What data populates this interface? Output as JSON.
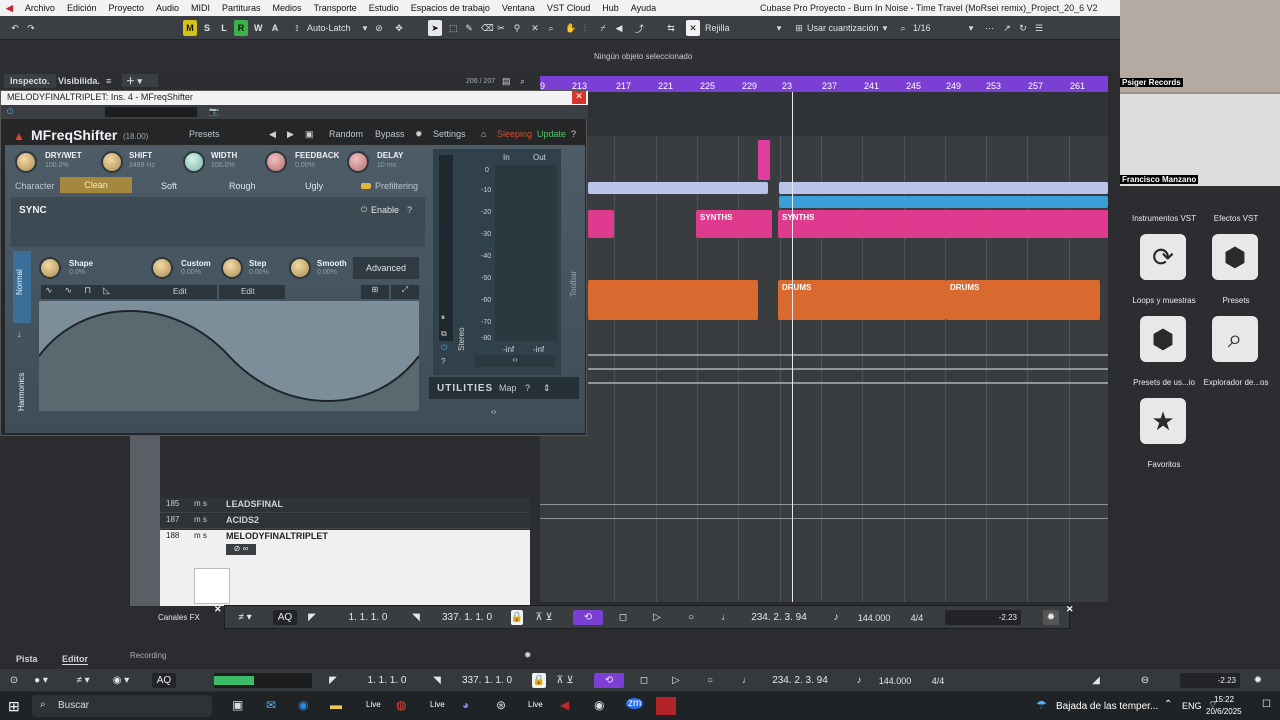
{
  "menubar": {
    "items": [
      "Archivo",
      "Edición",
      "Proyecto",
      "Audio",
      "MIDI",
      "Partituras",
      "Medios",
      "Transporte",
      "Estudio",
      "Espacios de trabajo",
      "Ventana",
      "VST Cloud",
      "Hub",
      "Ayuda"
    ],
    "window_title": "Cubase Pro Proyecto - Burn In Noise - Time Travel (MoRsei remix)_Project_20_6 V2"
  },
  "toolbar": {
    "m": "M",
    "s": "S",
    "l": "L",
    "r": "R",
    "w": "W",
    "a": "A",
    "autolatch": "Auto-Latch",
    "grid": "Rejilla",
    "quantize_mode": "Usar cuantización",
    "quantize": "1/16"
  },
  "status": {
    "no_object": "Ningún objeto seleccionado",
    "track_count": "206 / 207"
  },
  "inspector": {
    "tab1": "Inspecto.",
    "tab2": "Visibilida."
  },
  "ruler": {
    "marks": [
      "9",
      "213",
      "217",
      "221",
      "225",
      "229",
      "23",
      "237",
      "241",
      "245",
      "249",
      "253",
      "257",
      "261"
    ]
  },
  "events": {
    "synths1": "SYNTHS",
    "synths2": "SYNTHS",
    "drums1": "DRUMS",
    "drums2": "DRUMS"
  },
  "plugin": {
    "window_title": "MELODYFINALTRIPLET: Ins. 4 - MFreqShifter",
    "name": "MFreqShifter",
    "version": "(18.00)",
    "presets": "Presets",
    "random": "Random",
    "bypass": "Bypass",
    "settings": "Settings",
    "sleeping": "Sleeping",
    "update": "Update",
    "knobs": [
      {
        "label": "DRY/WET",
        "value": "100.0%"
      },
      {
        "label": "SHIFT",
        "value": "2489 Hz"
      },
      {
        "label": "WIDTH",
        "value": "100.0%"
      },
      {
        "label": "FEEDBACK",
        "value": "0.00%"
      },
      {
        "label": "DELAY",
        "value": "10 ms"
      }
    ],
    "character": "Character",
    "char_modes": [
      "Clean",
      "Soft",
      "Rough",
      "Ugly"
    ],
    "prefiltering": "Prefiltering",
    "sync": "SYNC",
    "enable": "Enable",
    "mod_knobs": [
      {
        "label": "Shape",
        "value": "0.0%"
      },
      {
        "label": "Custom",
        "value": "0.00%"
      },
      {
        "label": "Step",
        "value": "0.00%"
      },
      {
        "label": "Smooth",
        "value": "0.00%"
      }
    ],
    "advanced": "Advanced",
    "edit1": "Edit",
    "edit2": "Edit",
    "normal": "Normal",
    "harmonics": "Harmonics",
    "meter_in": "In",
    "meter_out": "Out",
    "meter_scale": [
      "0",
      "-10",
      "-20",
      "-30",
      "-40",
      "-50",
      "-60",
      "-70",
      "-80"
    ],
    "inf_in": "-inf",
    "inf_out": "-inf",
    "stereo": "Stereo",
    "toolbar_label": "Toolbar",
    "utilities": "UTILITIES",
    "map": "Map"
  },
  "tracks": [
    {
      "num": "185",
      "name": "LEADSFINAL"
    },
    {
      "num": "187",
      "name": "ACIDS2"
    },
    {
      "num": "188",
      "name": "MELODYFINALTRIPLET"
    }
  ],
  "lower": {
    "channels": "Canales FX",
    "pista": "Pista",
    "editor": "Editor",
    "recording": "Recording"
  },
  "transport": {
    "aq": "AQ",
    "left_locator": "1. 1. 1. 0",
    "right_locator": "337. 1. 1. 0",
    "position": "234. 2. 3. 94",
    "tempo": "144.000",
    "signature": "4/4",
    "level": "-2.23"
  },
  "rightpanel": {
    "items": [
      {
        "icon": "vst-instruments-icon",
        "label": "Instrumentos VST"
      },
      {
        "icon": "vst-effects-icon",
        "label": "Efectos VST"
      },
      {
        "icon": "loops-icon",
        "label": "Loops y muestras"
      },
      {
        "icon": "presets-icon",
        "label": "Presets"
      },
      {
        "icon": "user-presets-icon",
        "label": "Presets de us...io"
      },
      {
        "icon": "explorer-icon",
        "label": "Explorador de...os"
      },
      {
        "icon": "favorites-icon",
        "label": "Favoritos"
      }
    ]
  },
  "webcam": {
    "name1": "Psiger Records",
    "name2": "Francisco Manzano"
  },
  "taskbar": {
    "search": "Buscar",
    "weather": "Bajada de las temper...",
    "lang": "ENG",
    "time": "15:22",
    "date": "20/6/2025"
  }
}
